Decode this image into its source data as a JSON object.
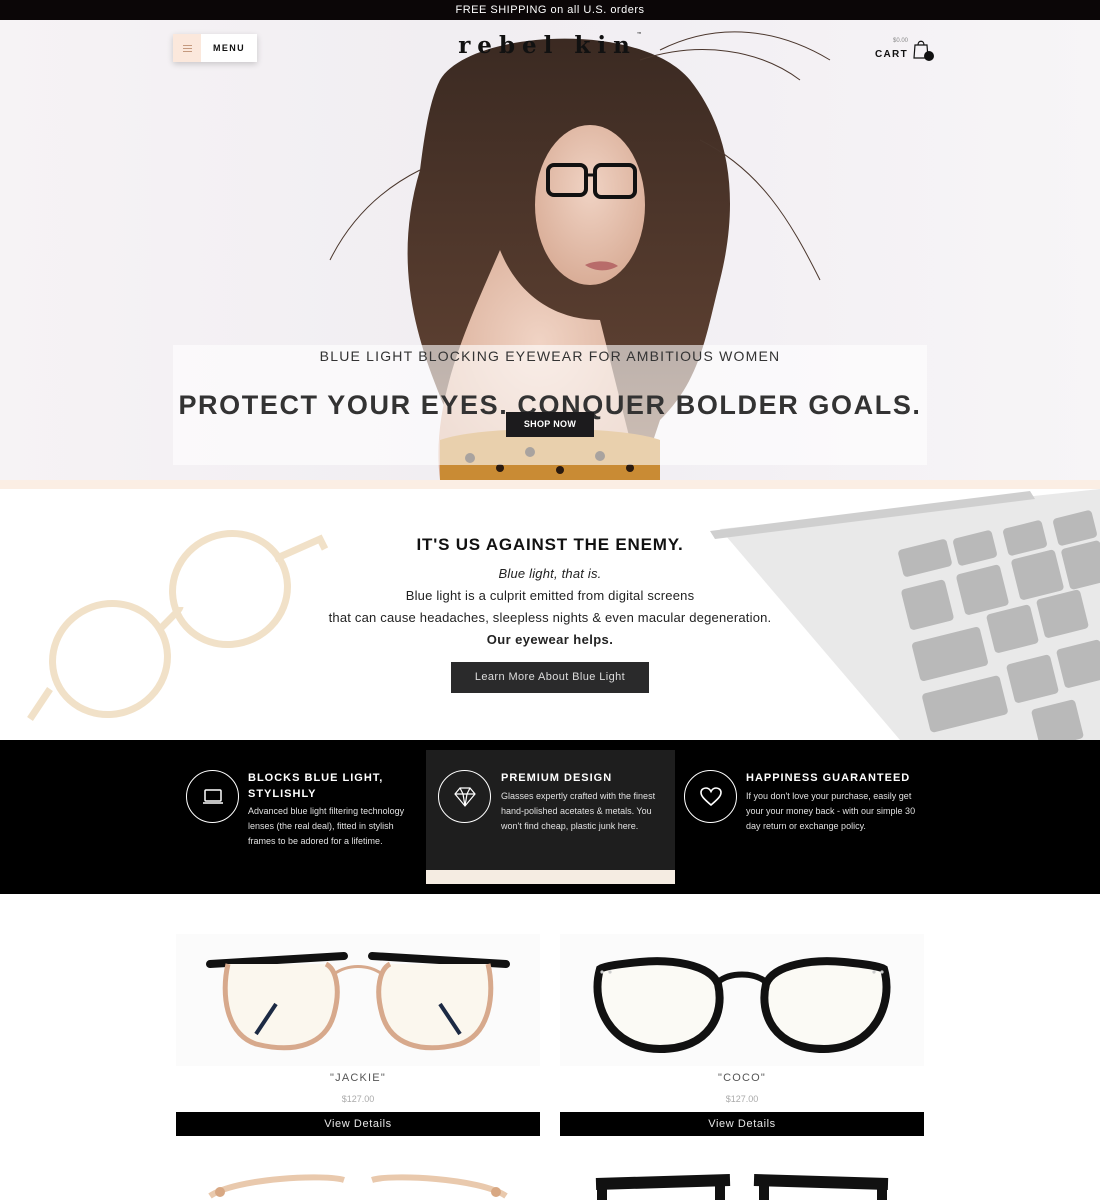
{
  "announcement": {
    "text": "FREE SHIPPING on all U.S. orders"
  },
  "header": {
    "menu_label": "MENU",
    "logo_text": "rebel kin",
    "logo_tm": "™",
    "cart_amount": "$0.00",
    "cart_label": "CART"
  },
  "hero": {
    "eyebrow": "BLUE LIGHT BLOCKING EYEWEAR FOR AMBITIOUS WOMEN",
    "headline": "PROTECT YOUR EYES. CONQUER BOLDER GOALS.",
    "cta": "SHOP NOW"
  },
  "enemy": {
    "heading": "IT'S US AGAINST THE ENEMY.",
    "line1": "Blue light, that is.",
    "line2": "Blue light is a culprit emitted from digital screens",
    "line3": "that can cause headaches, sleepless nights & even macular degeneration.",
    "line4": "Our eyewear helps.",
    "cta": "Learn More About Blue Light"
  },
  "features": [
    {
      "title": "BLOCKS BLUE LIGHT, STYLISHLY",
      "desc": "Advanced blue light filtering technology lenses (the real deal), fitted in stylish frames to be adored for a lifetime.",
      "icon": "laptop-icon"
    },
    {
      "title": "PREMIUM DESIGN",
      "desc": "Glasses expertly crafted with the finest hand-polished acetates & metals. You won't find cheap, plastic junk here.",
      "icon": "diamond-icon"
    },
    {
      "title": "HAPPINESS GUARANTEED",
      "desc": "If you don't love your purchase, easily get your your money back - with our simple 30 day return or exchange policy.",
      "icon": "heart-icon"
    }
  ],
  "products": [
    {
      "name": "\"JACKIE\"",
      "price": "$127.00",
      "cta": "View Details"
    },
    {
      "name": "\"COCO\"",
      "price": "$127.00",
      "cta": "View Details"
    }
  ],
  "colors": {
    "announce_bg": "#0b0607",
    "peach": "#fbeee4",
    "button_dark": "#1c1b1d",
    "features_bg": "#000000",
    "cream": "#f5ece2"
  }
}
